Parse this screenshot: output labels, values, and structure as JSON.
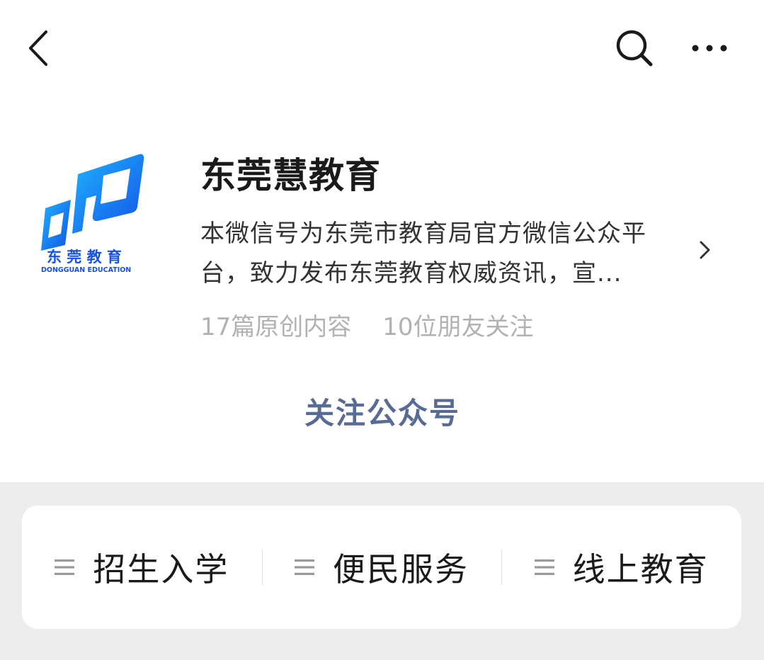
{
  "account": {
    "name": "东莞慧教育",
    "description": "本微信号为东莞市教育局官方微信公众平台，致力发布东莞教育权威资讯，宣...",
    "stats": {
      "original_articles": "17篇原创内容",
      "friends_following": "10位朋友关注"
    },
    "logo_icon": "dongguan-education-logo",
    "logo_text": "东 莞 教 育",
    "logo_subtext": "DONGGUAN EDUCATION"
  },
  "follow_button": {
    "label": "关注公众号",
    "color": "#576b95"
  },
  "menu": {
    "items": [
      {
        "label": "招生入学",
        "icon": "menu-lines-icon"
      },
      {
        "label": "便民服务",
        "icon": "menu-lines-icon"
      },
      {
        "label": "线上教育",
        "icon": "menu-lines-icon"
      }
    ]
  },
  "colors": {
    "brand_blue": "#1565f0",
    "background": "#ededed"
  }
}
